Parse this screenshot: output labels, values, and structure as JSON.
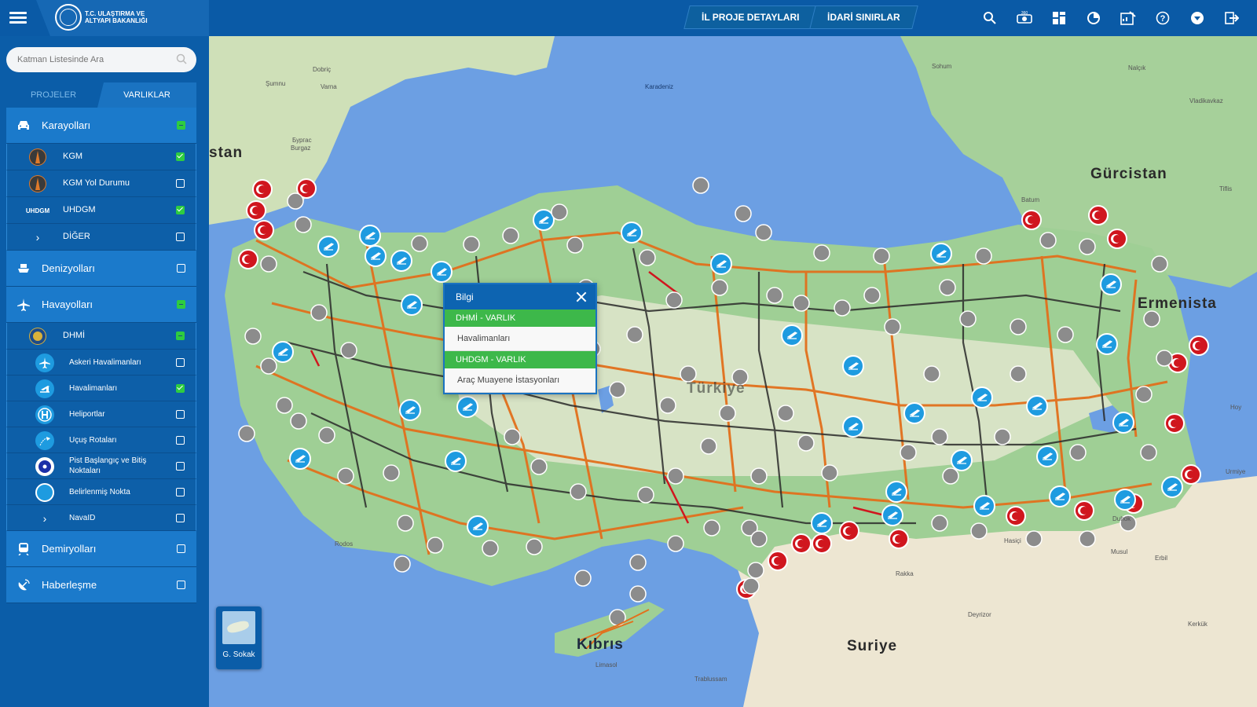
{
  "header": {
    "logo_text": "T.C. ULAŞTIRMA VE ALTYAPI BAKANLIĞI",
    "tabs": [
      "İL PROJE DETAYLARI",
      "İDARİ SINIRLAR"
    ],
    "icons": [
      "search-icon",
      "360-panorama-icon",
      "dashboard-grid-icon",
      "pie-chart-icon",
      "report-edit-icon",
      "help-icon",
      "dropdown-icon",
      "logout-icon"
    ]
  },
  "sidebar": {
    "search_placeholder": "Katman Listesinde Ara",
    "tabs": {
      "projeler": "PROJELER",
      "varliklar": "VARLIKLAR"
    },
    "categories": {
      "karayollari": "Karayolları",
      "denizyollari": "Denizyolları",
      "havayollari": "Havayolları",
      "demiryollari": "Demiryolları",
      "haberlesme": "Haberleşme"
    },
    "karayollari_items": {
      "kgm": "KGM",
      "kgm_yol": "KGM Yol Durumu",
      "uhdgm": "UHDGM",
      "diger": "DİĞER"
    },
    "uhdgm_logo_text": "UHDGM",
    "havayollari_items": {
      "dhmi": "DHMİ",
      "askeri": "Askeri Havalimanları",
      "havalimanlari": "Havalimanları",
      "heliportlar": "Heliportlar",
      "ucus": "Uçuş Rotaları",
      "pist": "Pist Başlangıç ve Bitiş Noktaları",
      "belirlenmis": "Belirlenmiş Nokta",
      "navaid": "NavaID"
    }
  },
  "map": {
    "countries": [
      "Gürcistan",
      "Ermenista",
      "Suriye",
      "Kıbrıs",
      "Türkiye",
      "stan"
    ],
    "sea_label": "Karadeniz",
    "cities": [
      "Varna",
      "Бургас",
      "Batum",
      "Tiflis",
      "Musul",
      "Erbil",
      "Rakka",
      "Kerkük",
      "Duhok",
      "Urmiye",
      "Hoy",
      "Limasol",
      "Trablussam",
      "Deyrizor",
      "Hasiçi",
      "Rodos",
      "Şumnu",
      "Dobriç",
      "Burgaz",
      "Sohum",
      "Nalçık",
      "Vladikavkaz"
    ]
  },
  "popup": {
    "title": "Bilgi",
    "groups": [
      {
        "name": "DHMİ - VARLIK",
        "items": [
          "Havalimanları"
        ]
      },
      {
        "name": "UHDGM - VARLIK",
        "items": [
          "Araç Muayene İstasyonları"
        ]
      }
    ]
  },
  "basemap": {
    "label": "G. Sokak"
  },
  "colors": {
    "primary": "#0b5da8",
    "category_bg": "#1b7acb",
    "accent_green": "#3db84a",
    "road_orange": "#e2701c",
    "road_black": "#2b2b2b",
    "sea": "#6c9fe3",
    "land_green": "#9fcf95",
    "airport_blue": "#1e9be0",
    "border_gate_red": "#d0161e"
  }
}
